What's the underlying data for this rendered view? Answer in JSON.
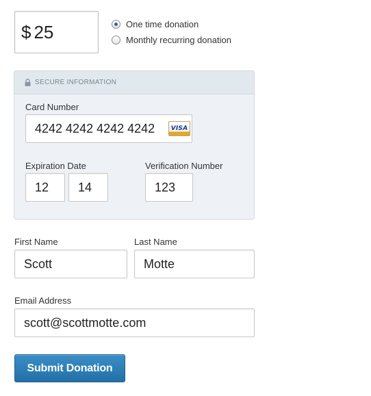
{
  "amount": {
    "currency": "$",
    "value": "25"
  },
  "donation_type": {
    "options": [
      {
        "label": "One time donation",
        "selected": true
      },
      {
        "label": "Monthly recurring donation",
        "selected": false
      }
    ]
  },
  "secure": {
    "header": "SECURE INFORMATION",
    "card_number_label": "Card Number",
    "card_number": "4242 4242 4242 4242",
    "card_brand": "VISA",
    "expiration_label": "Expiration Date",
    "exp_month": "12",
    "exp_year": "14",
    "verification_label": "Verification Number",
    "verification": "123"
  },
  "person": {
    "first_name_label": "First Name",
    "first_name": "Scott",
    "last_name_label": "Last Name",
    "last_name": "Motte",
    "email_label": "Email Address",
    "email": "scott@scottmotte.com"
  },
  "submit_label": "Submit Donation",
  "colors": {
    "accent": "#2a7ab8",
    "secure_bg": "#eef2f6",
    "secure_header_bg": "#e1e8ee"
  },
  "icons": {
    "lock": "lock-icon",
    "card": "visa-card-icon"
  }
}
